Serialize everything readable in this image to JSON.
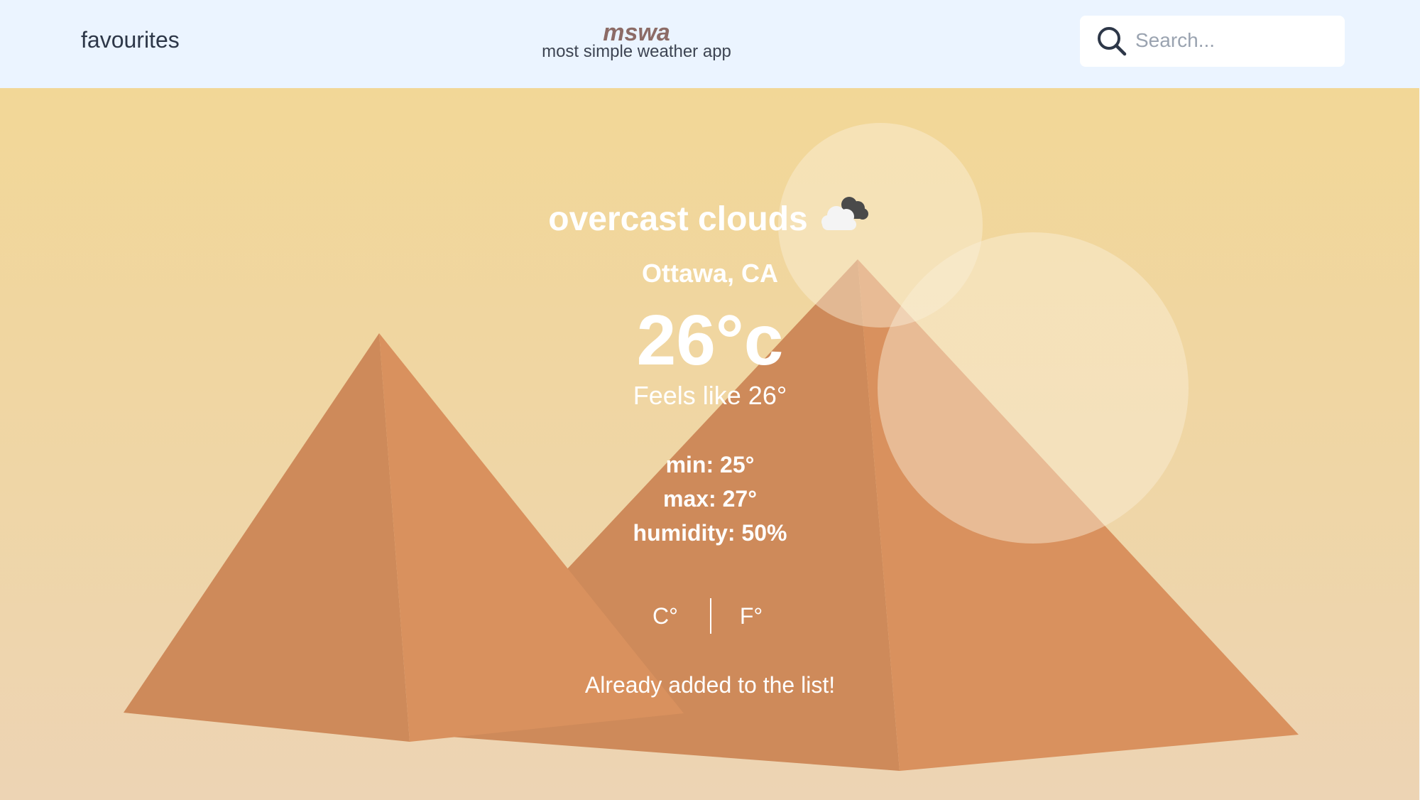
{
  "header": {
    "favourites_label": "favourites",
    "brand_name": "mswa",
    "brand_tagline": "most simple weather app",
    "search_placeholder": "Search...",
    "search_value": "",
    "search_icon": "search-icon"
  },
  "weather": {
    "condition": "overcast clouds",
    "condition_icon": "overcast-clouds-icon",
    "location": "Ottawa, CA",
    "temperature": "26°c",
    "feels_like": "Feels like 26°",
    "min": "min: 25°",
    "max": "max: 27°",
    "humidity": "humidity: 50%"
  },
  "units": {
    "celsius_label": "C°",
    "fahrenheit_label": "F°"
  },
  "status": {
    "message": "Already added to the list!"
  },
  "theme": {
    "header_bg": "#ebf4ff",
    "sky_top": "#f2d797",
    "sand_bottom": "#edd4b4",
    "pyramid_shadow": "#ce8a5a",
    "pyramid_light": "#d9915e",
    "text": "#ffffff",
    "brand_color": "#8c6b66"
  }
}
